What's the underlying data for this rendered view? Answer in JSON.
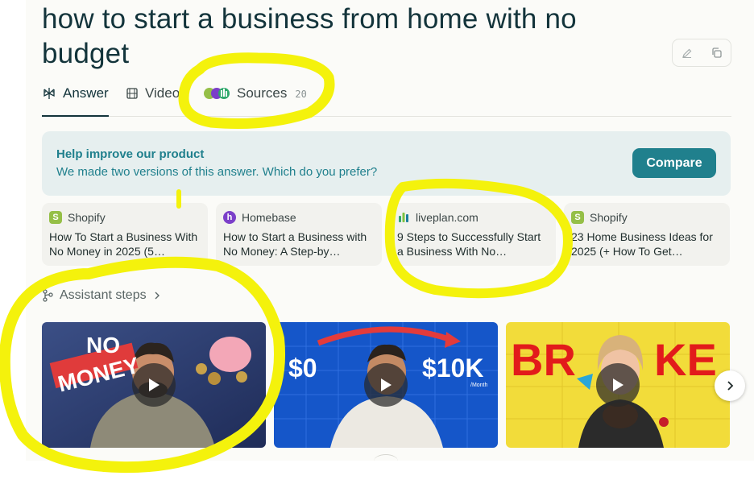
{
  "query": {
    "title": "how to start a business from home with no budget"
  },
  "tabs": [
    {
      "label": "Answer",
      "icon": "perplexity-answer-icon",
      "active": true
    },
    {
      "label": "Videos",
      "icon": "film-icon",
      "active": false
    },
    {
      "label": "Sources",
      "icon": "source-favicons-stack",
      "count": "20",
      "active": false
    }
  ],
  "actions": {
    "edit_icon": "pencil-icon",
    "copy_icon": "copy-icon"
  },
  "banner": {
    "title": "Help improve our product",
    "subtitle": "We made two versions of this answer. Which do you prefer?",
    "button": "Compare"
  },
  "sources": [
    {
      "site": "Shopify",
      "title": "How To Start a Business With No Money in 2025 (5…",
      "icon": "shopify-icon"
    },
    {
      "site": "Homebase",
      "title": "How to Start a Business with No Money: A Step-by…",
      "icon": "homebase-icon"
    },
    {
      "site": "liveplan.com",
      "title": "9 Steps to Successfully Start a Business With No…",
      "icon": "liveplan-icon"
    },
    {
      "site": "Shopify",
      "title": "23 Home Business Ideas for 2025 (+ How To Get…",
      "icon": "shopify-icon"
    }
  ],
  "assistant_steps": {
    "label": "Assistant steps"
  },
  "videos": [
    {
      "thumb_text_1": "NO",
      "thumb_text_2": "MONEY"
    },
    {
      "thumb_text_1": "$0",
      "thumb_text_2": "$10K",
      "thumb_text_3": "/Month"
    },
    {
      "thumb_text_1": "BR",
      "thumb_text_2": "KE"
    }
  ],
  "colors": {
    "accent": "#20808d",
    "title": "#13343b",
    "highlight": "#f4f20c"
  }
}
